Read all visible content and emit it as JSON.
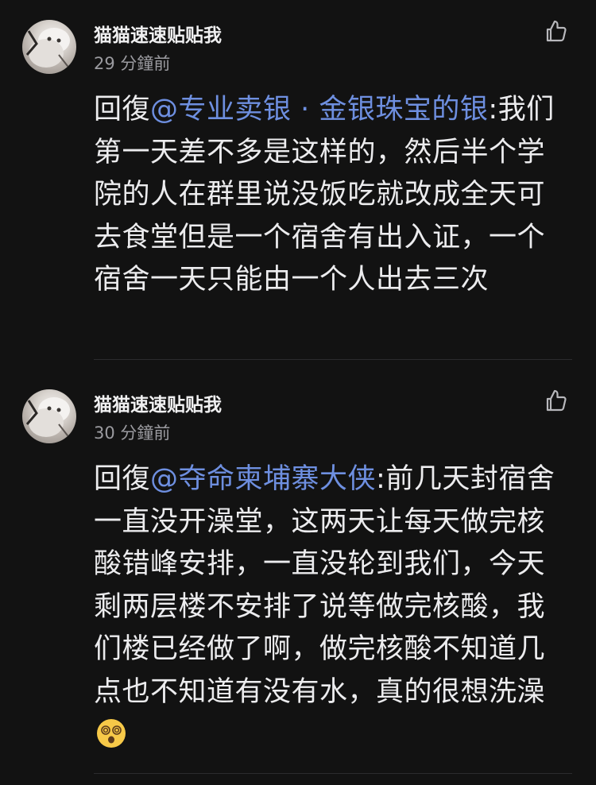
{
  "comments": [
    {
      "username": "猫猫速速贴贴我",
      "time": "29 分鐘前",
      "reply_prefix": "回復",
      "mention": "@专业卖银 · 金银珠宝的银",
      "text": ":我们第一天差不多是这样的，然后半个学院的人在群里说没饭吃就改成全天可去食堂但是一个宿舍有出入证，一个宿舍一天只能由一个人出去三次"
    },
    {
      "username": "猫猫速速贴贴我",
      "time": "30 分鐘前",
      "reply_prefix": "回復",
      "mention": "@夺命柬埔寨大侠",
      "text": ":前几天封宿舍一直没开澡堂，这两天让每天做完核酸错峰安排，一直没轮到我们，今天剩两层楼不安排了说等做完核酸，我们楼已经做了啊，做完核酸不知道几点也不知道有没有水，真的很想洗澡",
      "emoji": "dizzy-face-icon"
    }
  ],
  "colors": {
    "background": "#121212",
    "mention": "#6e8fe0",
    "text": "#ececee",
    "muted": "#9b9ba0"
  }
}
